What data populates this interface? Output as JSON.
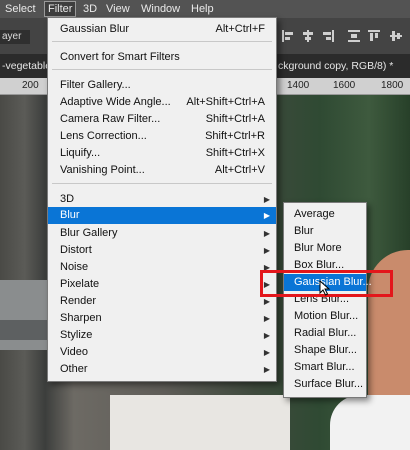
{
  "menubar": {
    "items": [
      "Select",
      "Filter",
      "3D",
      "View",
      "Window",
      "Help"
    ]
  },
  "options": {
    "field": "ayer"
  },
  "tabs": {
    "left": "-vegetable",
    "right": "ckground copy, RGB/8) *"
  },
  "ruler": {
    "ticks": [
      "200",
      "1400",
      "1600",
      "1800"
    ]
  },
  "filter_menu": {
    "items": [
      {
        "label": "Gaussian Blur",
        "shortcut": "Alt+Ctrl+F"
      },
      {
        "label": "Convert for Smart Filters",
        "shortcut": ""
      },
      {
        "label": "Filter Gallery...",
        "shortcut": ""
      },
      {
        "label": "Adaptive Wide Angle...",
        "shortcut": "Alt+Shift+Ctrl+A"
      },
      {
        "label": "Camera Raw Filter...",
        "shortcut": "Shift+Ctrl+A"
      },
      {
        "label": "Lens Correction...",
        "shortcut": "Shift+Ctrl+R"
      },
      {
        "label": "Liquify...",
        "shortcut": "Shift+Ctrl+X"
      },
      {
        "label": "Vanishing Point...",
        "shortcut": "Alt+Ctrl+V"
      },
      {
        "label": "3D",
        "shortcut": ""
      },
      {
        "label": "Blur",
        "shortcut": ""
      },
      {
        "label": "Blur Gallery",
        "shortcut": ""
      },
      {
        "label": "Distort",
        "shortcut": ""
      },
      {
        "label": "Noise",
        "shortcut": ""
      },
      {
        "label": "Pixelate",
        "shortcut": ""
      },
      {
        "label": "Render",
        "shortcut": ""
      },
      {
        "label": "Sharpen",
        "shortcut": ""
      },
      {
        "label": "Stylize",
        "shortcut": ""
      },
      {
        "label": "Video",
        "shortcut": ""
      },
      {
        "label": "Other",
        "shortcut": ""
      }
    ]
  },
  "blur_submenu": {
    "items": [
      "Average",
      "Blur",
      "Blur More",
      "Box Blur...",
      "Gaussian Blur...",
      "Lens Blur...",
      "Motion Blur...",
      "Radial Blur...",
      "Shape Blur...",
      "Smart Blur...",
      "Surface Blur..."
    ]
  },
  "colors": {
    "highlight": "#0a75d6",
    "annotation_box": "#e3161b",
    "menu_bg": "#f0f0f0",
    "menubar_bg": "#535353"
  },
  "icons": [
    "align-left-icon",
    "align-center-icon",
    "align-right-icon",
    "distribute-icon",
    "arrow-cursor-icon",
    "submenu-arrow-icon"
  ]
}
